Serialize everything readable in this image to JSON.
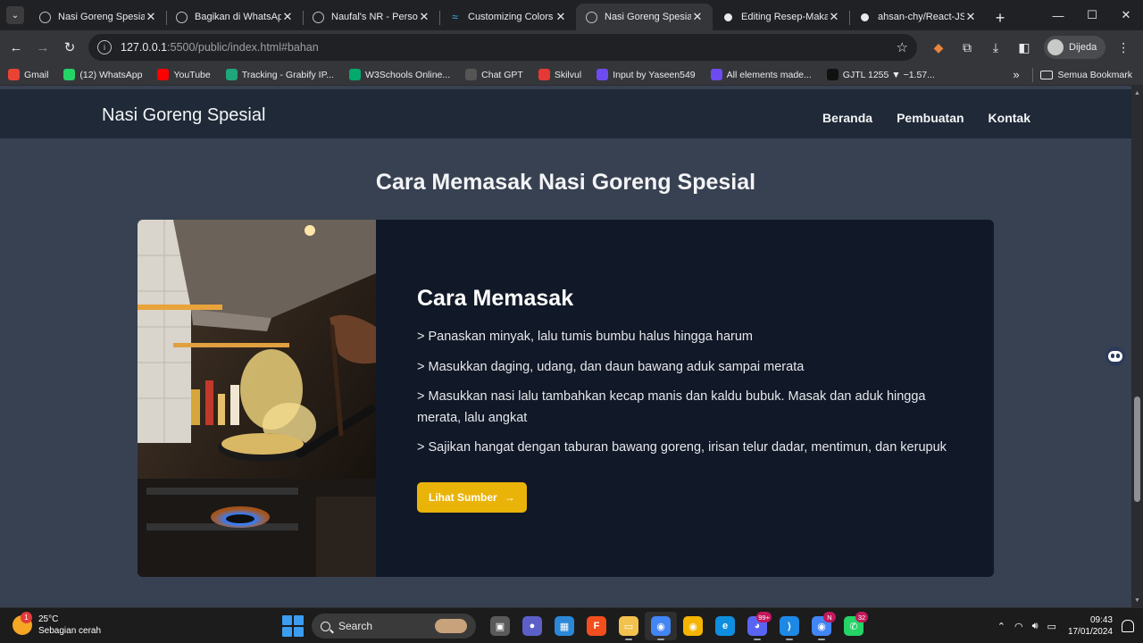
{
  "browser": {
    "tabs": [
      {
        "title": "Nasi Goreng Spesial",
        "favicon": "globe-icon",
        "active": false
      },
      {
        "title": "Bagikan di WhatsApp",
        "favicon": "globe-icon",
        "active": false
      },
      {
        "title": "Naufal's NR - Personal",
        "favicon": "globe-icon",
        "active": false
      },
      {
        "title": "Customizing Colors",
        "favicon": "tailwind-icon",
        "active": false
      },
      {
        "title": "Nasi Goreng Spesial",
        "favicon": "globe-icon",
        "active": true
      },
      {
        "title": "Editing Resep-Makanan",
        "favicon": "github-icon",
        "active": false
      },
      {
        "title": "ahsan-chy/React-JS",
        "favicon": "github-icon",
        "active": false
      }
    ],
    "url_host": "127.0.0.1",
    "url_rest": ":5500/public/index.html#bahan",
    "profile_label": "Dijeda",
    "bookmarks": [
      {
        "label": "Gmail",
        "icon": "gmail-icon",
        "color": "#ea4335"
      },
      {
        "label": "(12) WhatsApp",
        "icon": "whatsapp-icon",
        "color": "#25d366"
      },
      {
        "label": "YouTube",
        "icon": "youtube-icon",
        "color": "#ff0000"
      },
      {
        "label": "Tracking - Grabify IP...",
        "icon": "grabify-icon",
        "color": "#1fa67a"
      },
      {
        "label": "W3Schools Online...",
        "icon": "w3schools-icon",
        "color": "#04aa6d"
      },
      {
        "label": "Chat GPT",
        "icon": "chatgpt-icon",
        "color": "#555555"
      },
      {
        "label": "Skilvul",
        "icon": "skilvul-icon",
        "color": "#e53935"
      },
      {
        "label": "Input by Yaseen549",
        "icon": "ui-icon",
        "color": "#6c4cf0"
      },
      {
        "label": "All elements made...",
        "icon": "ui-icon",
        "color": "#6c4cf0"
      },
      {
        "label": "GJTL 1255 ▼ −1.57...",
        "icon": "tradingview-icon",
        "color": "#111111"
      }
    ],
    "all_bookmarks_label": "Semua Bookmark"
  },
  "site": {
    "brand": "Nasi Goreng Spesial",
    "nav": [
      "Beranda",
      "Pembuatan",
      "Kontak"
    ],
    "section_title": "Cara Memasak Nasi Goreng Spesial",
    "card": {
      "heading": "Cara Memasak",
      "steps": [
        "> Panaskan minyak, lalu tumis bumbu halus hingga harum",
        "> Masukkan daging, udang, dan daun bawang aduk sampai merata",
        "> Masukkan nasi lalu tambahkan kecap manis dan kaldu bubuk. Masak dan aduk hingga merata, lalu angkat",
        "> Sajikan hangat dengan taburan bawang goreng, irisan telur dadar, mentimun, dan kerupuk"
      ],
      "button_label": "Lihat Sumber",
      "button_color": "#eab308"
    }
  },
  "taskbar": {
    "temperature": "25°C",
    "weather": "Sebagian cerah",
    "weather_badge": "1",
    "search_placeholder": "Search",
    "apps": [
      {
        "name": "task-view-icon",
        "color": "#5a5a5a",
        "glyph": "▣",
        "badge": ""
      },
      {
        "name": "meet-icon",
        "color": "#5b5fc7",
        "glyph": "●",
        "badge": ""
      },
      {
        "name": "store-icon",
        "color": "#2b88d8",
        "glyph": "▦",
        "badge": ""
      },
      {
        "name": "figma-icon",
        "color": "#f24e1e",
        "glyph": "F",
        "badge": ""
      },
      {
        "name": "file-explorer-icon",
        "color": "#f2c14e",
        "glyph": "▭",
        "badge": ""
      },
      {
        "name": "chrome-icon",
        "color": "#4285f4",
        "glyph": "◉",
        "badge": ""
      },
      {
        "name": "chrome-canary-icon",
        "color": "#f4b400",
        "glyph": "◉",
        "badge": ""
      },
      {
        "name": "edge-icon",
        "color": "#0f8ee0",
        "glyph": "e",
        "badge": ""
      },
      {
        "name": "discord-icon",
        "color": "#5865f2",
        "glyph": "◕",
        "badge": "99+"
      },
      {
        "name": "vscode-icon",
        "color": "#1e88e5",
        "glyph": "⟩",
        "badge": ""
      },
      {
        "name": "chrome-profile-icon",
        "color": "#4285f4",
        "glyph": "◉",
        "badge": "N"
      },
      {
        "name": "whatsapp-icon",
        "color": "#25d366",
        "glyph": "✆",
        "badge": "32"
      }
    ],
    "time": "09:43",
    "date": "17/01/2024"
  }
}
